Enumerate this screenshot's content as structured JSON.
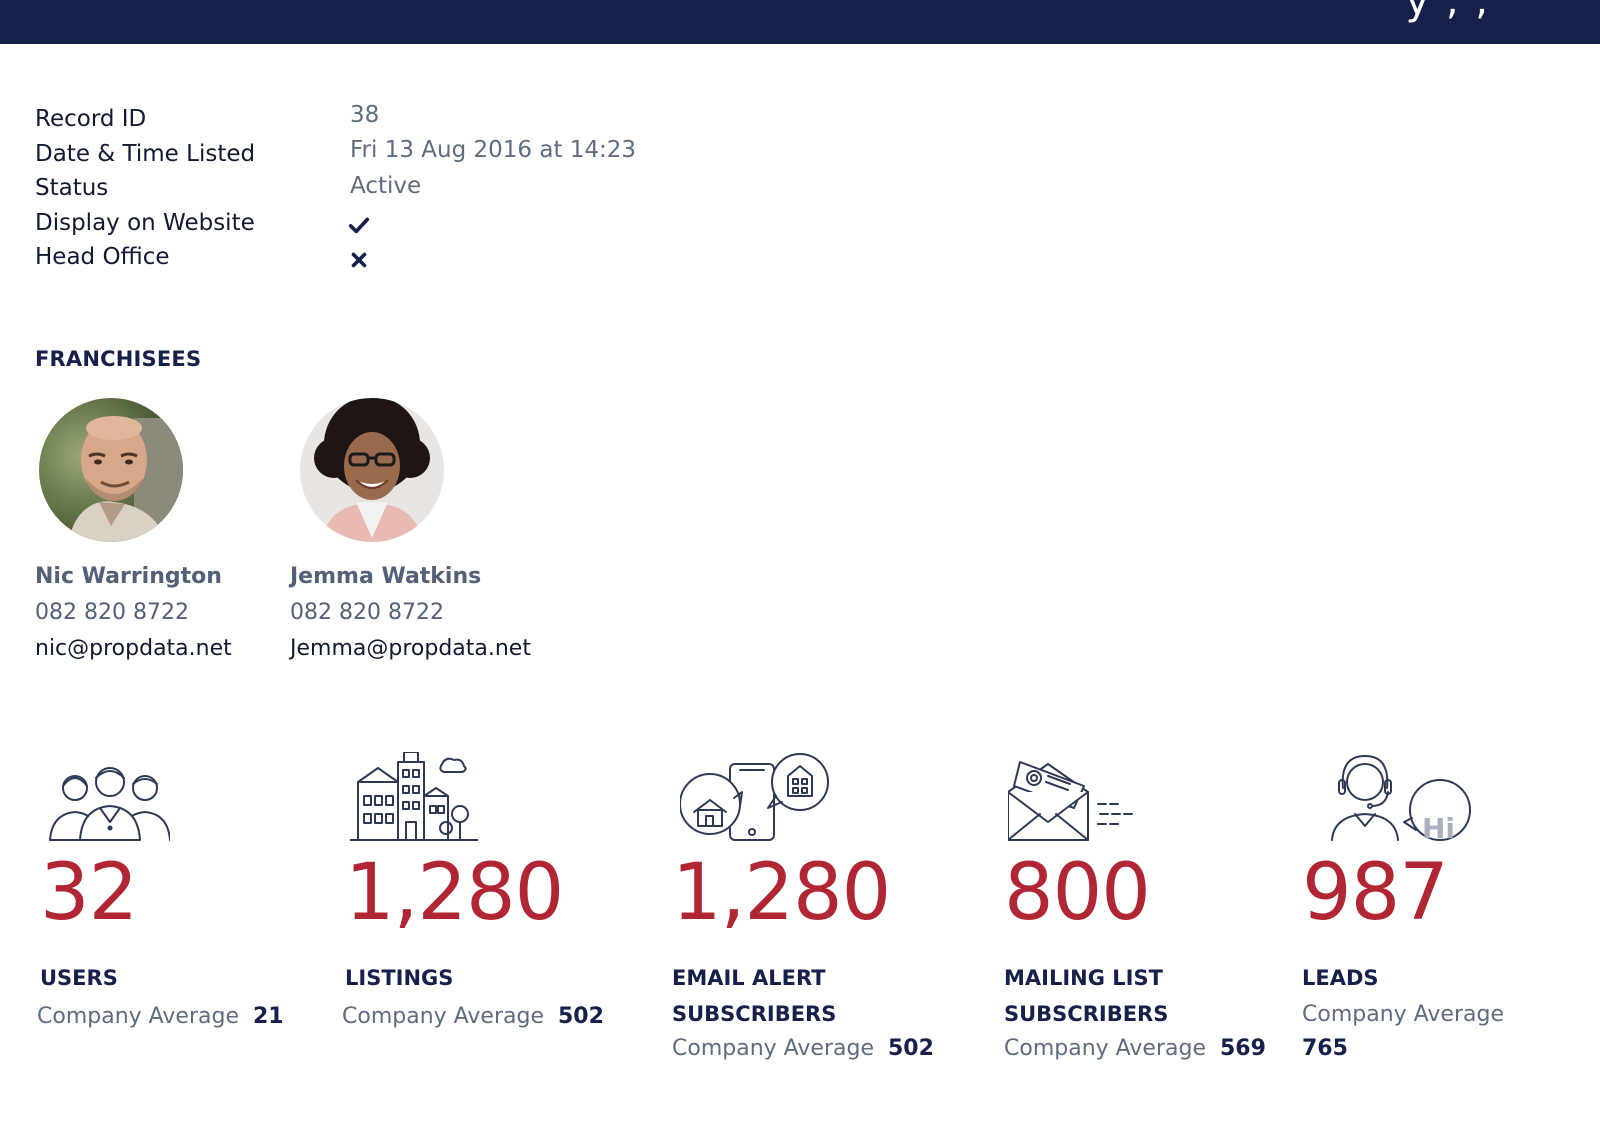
{
  "header": {
    "title": "y , ,"
  },
  "details": [
    {
      "label": "Record ID",
      "value": "38"
    },
    {
      "label": "Date & Time Listed",
      "value": "Fri 13 Aug 2016 at 14:23"
    },
    {
      "label": "Status",
      "value": "Active"
    },
    {
      "label": "Display on Website",
      "value_icon": "check-icon"
    },
    {
      "label": "Head Office",
      "value_icon": "cross-icon"
    }
  ],
  "franchisees": {
    "heading": "FRANCHISEES",
    "people": [
      {
        "name": "Nic Warrington",
        "phone": "082 820 8722",
        "email": "nic@propdata.net",
        "avatar": "avatar-man-photo"
      },
      {
        "name": "Jemma Watkins",
        "phone": "082 820 8722",
        "email": "Jemma@propdata.net",
        "avatar": "avatar-woman-photo"
      }
    ]
  },
  "stats": [
    {
      "icon": "users-group-icon",
      "value": "32",
      "label_line1": "USERS",
      "label_line2": "",
      "avg_label": "Company Average",
      "avg_value": "21"
    },
    {
      "icon": "buildings-icon",
      "value": "1,280",
      "label_line1": "LISTINGS",
      "label_line2": "",
      "avg_label": "Company Average",
      "avg_value": "502"
    },
    {
      "icon": "mobile-property-alert-icon",
      "value": "1,280",
      "label_line1": "EMAIL ALERT",
      "label_line2": "SUBSCRIBERS",
      "avg_label": "Company Average",
      "avg_value": "502"
    },
    {
      "icon": "envelope-mail-icon",
      "value": "800",
      "label_line1": "MAILING LIST",
      "label_line2": "SUBSCRIBERS",
      "avg_label": "Company Average",
      "avg_value": "569"
    },
    {
      "icon": "support-agent-hi-icon",
      "value": "987",
      "label_line1": "LEADS",
      "label_line2": "",
      "avg_label": "Company Average",
      "avg_value": "765"
    }
  ],
  "colors": {
    "header_bg": "#16204a",
    "accent_red": "#b02634",
    "heading_navy": "#16204a",
    "muted_text": "#5f6c80"
  }
}
